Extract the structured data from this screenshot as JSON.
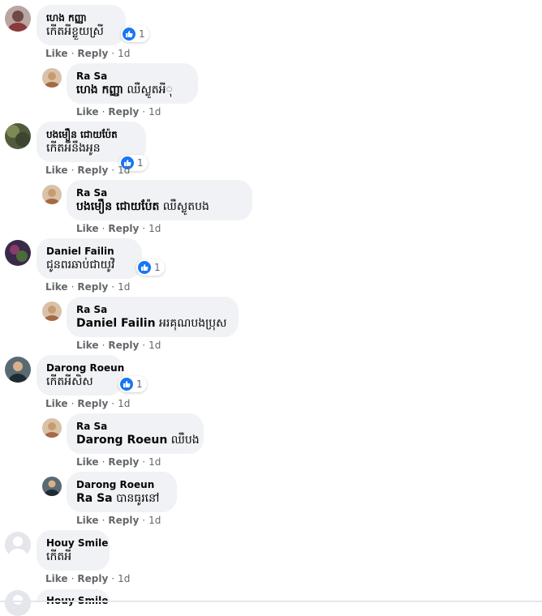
{
  "action_labels": {
    "like": "Like",
    "reply": "Reply",
    "time": "1d",
    "sep": "·"
  },
  "comments": [
    {
      "author": "ហេង កញ្ញា",
      "text": "កើតអីខ្លួយស្រី",
      "reaction_count": "1"
    },
    {
      "author": "Ra Sa",
      "mention": "ហេង កញ្ញា",
      "text": " ឈឺស្លូតអីុ"
    },
    {
      "author": "បងមឿន ជោយប៉ែត",
      "text": "កើតអីនឹងអូន",
      "reaction_count": "1"
    },
    {
      "author": "Ra Sa",
      "mention": "បងមឿន ជោយប៉ែត",
      "text": " ឈឺស្លូតបង"
    },
    {
      "author": "Daniel Failin",
      "text": "ជូនពរឆាប់ជាយូវិ",
      "reaction_count": "1"
    },
    {
      "author": "Ra Sa",
      "mention": "Daniel Failin",
      "text": " អរគុណបងប្រុស"
    },
    {
      "author": "Darong Roeun",
      "text": "កើតអីសិស",
      "reaction_count": "1"
    },
    {
      "author": "Ra Sa",
      "mention": "Darong Roeun",
      "text": " ឈឺបង"
    },
    {
      "author": "Darong Roeun",
      "mention": "Ra Sa",
      "text": " បានធូរនៅ"
    },
    {
      "author": "Houy Smile",
      "text": "កើតអី"
    },
    {
      "author": "Houy Smile"
    }
  ],
  "colors": {
    "bubble": "#f0f2f5",
    "meta": "#65676b",
    "like_blue": "#1877f2"
  },
  "icons": {
    "like": "thumbs-up-icon"
  }
}
